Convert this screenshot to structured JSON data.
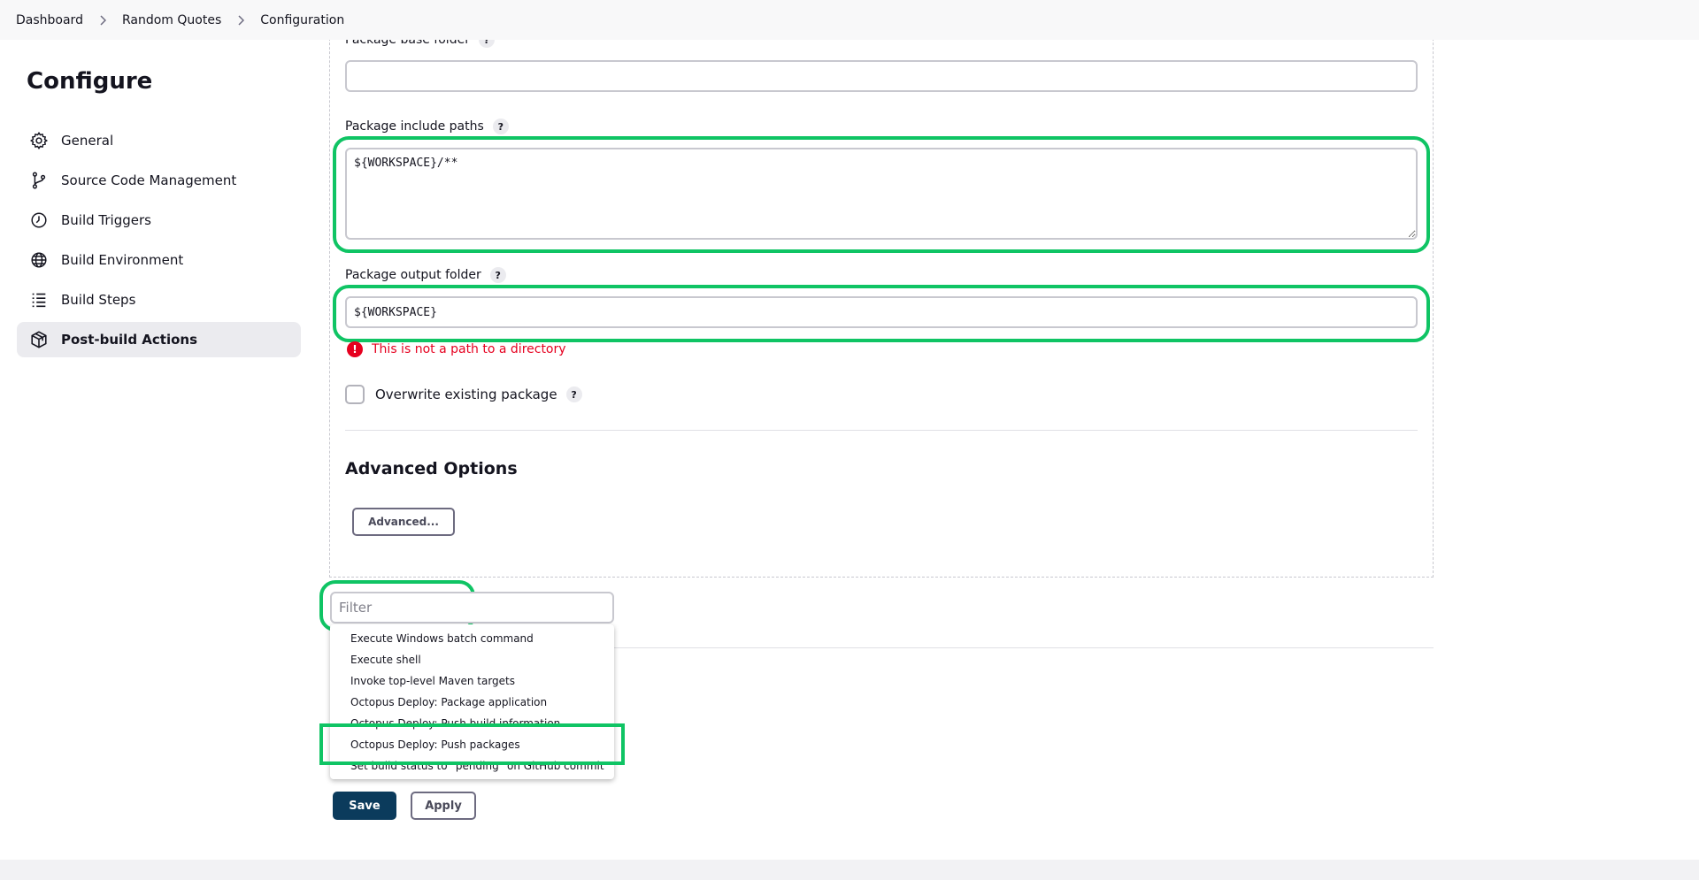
{
  "breadcrumb": {
    "items": [
      "Dashboard",
      "Random Quotes",
      "Configuration"
    ]
  },
  "sidebar": {
    "title": "Configure",
    "items": [
      {
        "label": "General",
        "icon": "gear-icon"
      },
      {
        "label": "Source Code Management",
        "icon": "branch-icon"
      },
      {
        "label": "Build Triggers",
        "icon": "clock-icon"
      },
      {
        "label": "Build Environment",
        "icon": "globe-icon"
      },
      {
        "label": "Build Steps",
        "icon": "list-icon"
      },
      {
        "label": "Post-build Actions",
        "icon": "package-icon",
        "active": true
      }
    ]
  },
  "form": {
    "base_folder": {
      "label": "Package base folder",
      "help": "?",
      "value": ""
    },
    "include_paths": {
      "label": "Package include paths",
      "help": "?",
      "value": "${WORKSPACE}/**"
    },
    "output_folder": {
      "label": "Package output folder",
      "help": "?",
      "value": "${WORKSPACE}",
      "error_icon": "!",
      "error": "This is not a path to a directory"
    },
    "overwrite": {
      "label": "Overwrite existing package",
      "help": "?",
      "checked": false
    },
    "advanced_heading": "Advanced Options",
    "advanced_button": "Advanced..."
  },
  "add_step": {
    "filter_placeholder": "Filter",
    "options": [
      "Execute Windows batch command",
      "Execute shell",
      "Invoke top-level Maven targets",
      "Octopus Deploy: Package application",
      "Octopus Deploy: Push build information",
      "Octopus Deploy: Push packages",
      "Set build status to \"pending\" on GitHub commit"
    ]
  },
  "actions": {
    "save": "Save",
    "apply": "Apply"
  },
  "colors": {
    "highlight": "#0fc464",
    "error": "#e6001f",
    "save_button": "#0b3b5c",
    "active_nav": "#ebebef"
  }
}
